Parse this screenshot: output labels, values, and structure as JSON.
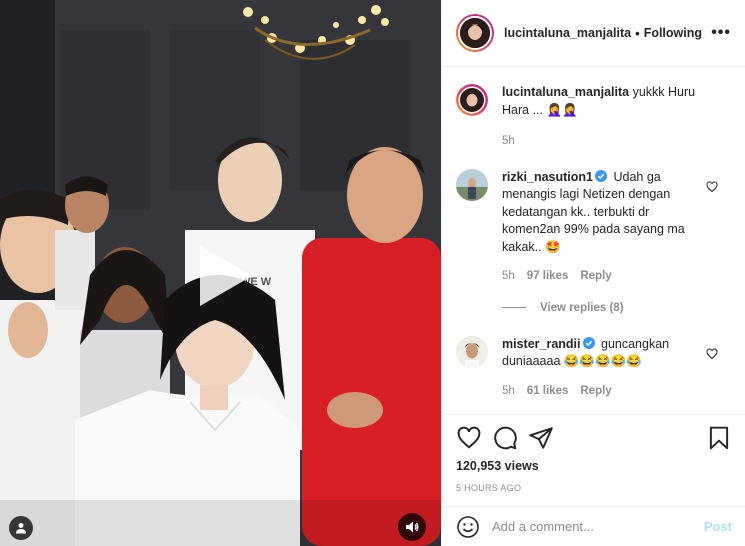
{
  "post": {
    "username": "lucintaluna_manjalita",
    "separator": "•",
    "follow_status": "Following",
    "more_label": "•••",
    "caption": {
      "username": "lucintaluna_manjalita",
      "text": "yukkk Huru Hara ... 🤦‍♀️🤦‍♀️",
      "time": "5h"
    }
  },
  "comments": [
    {
      "username": "rizki_nasution1",
      "verified": true,
      "text": "Udah ga menangis lagi Netizen dengan kedatangan kk.. terbukti dr komen2an 99% pada sayang ma kakak.. 🤩",
      "time": "5h",
      "likes": "97 likes",
      "reply_label": "Reply",
      "view_replies": "View replies (8)"
    },
    {
      "username": "mister_randii",
      "verified": true,
      "text": "guncangkan duniaaaaa 😂😂😂😂😂",
      "time": "5h",
      "likes": "61 likes",
      "reply_label": "Reply"
    }
  ],
  "stats": {
    "views": "120,953 views",
    "time_ago": "5 HOURS AGO"
  },
  "composer": {
    "placeholder": "Add a comment...",
    "post_label": "Post"
  },
  "icons": {
    "like": "heart-icon",
    "comment": "comment-icon",
    "share": "share-icon",
    "save": "bookmark-icon",
    "play": "play-icon",
    "tagged": "user-icon",
    "sound": "speaker-icon",
    "emoji": "emoji-icon",
    "verified": "verified-badge-icon"
  },
  "colors": {
    "verified": "#3897f0",
    "post_disabled": "#b2dffc",
    "muted": "#8e8e8e",
    "text": "#262626"
  }
}
